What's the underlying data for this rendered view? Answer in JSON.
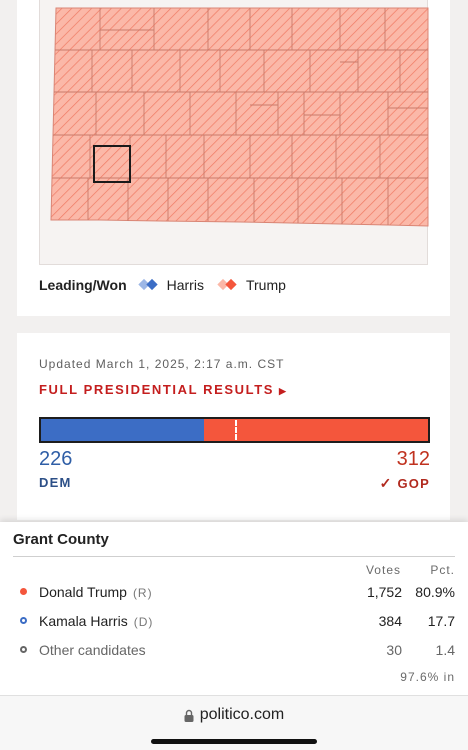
{
  "map": {
    "legend_lead": "Leading/Won",
    "legend_items": [
      {
        "name": "Harris",
        "color": "#3c6dc5",
        "icon": "harris-diamond-icon"
      },
      {
        "name": "Trump",
        "color": "#f4563c",
        "icon": "trump-diamond-icon"
      }
    ],
    "fill_color": "#fbb8a8",
    "hatch_color": "#ef7a63"
  },
  "results": {
    "updated": "Updated March 1, 2025, 2:17 a.m. CST",
    "full_link": "FULL PRESIDENTIAL RESULTS",
    "link_icon": "triangle-right-icon",
    "dem_votes": "226",
    "gop_votes": "312",
    "dem_label": "DEM",
    "gop_label": "GOP",
    "gop_check_icon": "checkmark-icon",
    "dem_share": 0.42,
    "dem_color": "#3c6dc5",
    "gop_color": "#f4563c"
  },
  "popup": {
    "county": "Grant County",
    "col_votes": "Votes",
    "col_pct": "Pct.",
    "rows": [
      {
        "name": "Donald Trump",
        "party": "(R)",
        "votes": "1,752",
        "pct": "80.9%",
        "dot": "filled-red"
      },
      {
        "name": "Kamala Harris",
        "party": "(D)",
        "votes": "384",
        "pct": "17.7",
        "dot": "ring-blue"
      },
      {
        "name": "Other candidates",
        "party": "",
        "votes": "30",
        "pct": "1.4",
        "dot": "ring-gray"
      }
    ],
    "reporting": "97.6% in"
  },
  "browser": {
    "url": "politico.com",
    "lock_icon": "lock-icon"
  }
}
